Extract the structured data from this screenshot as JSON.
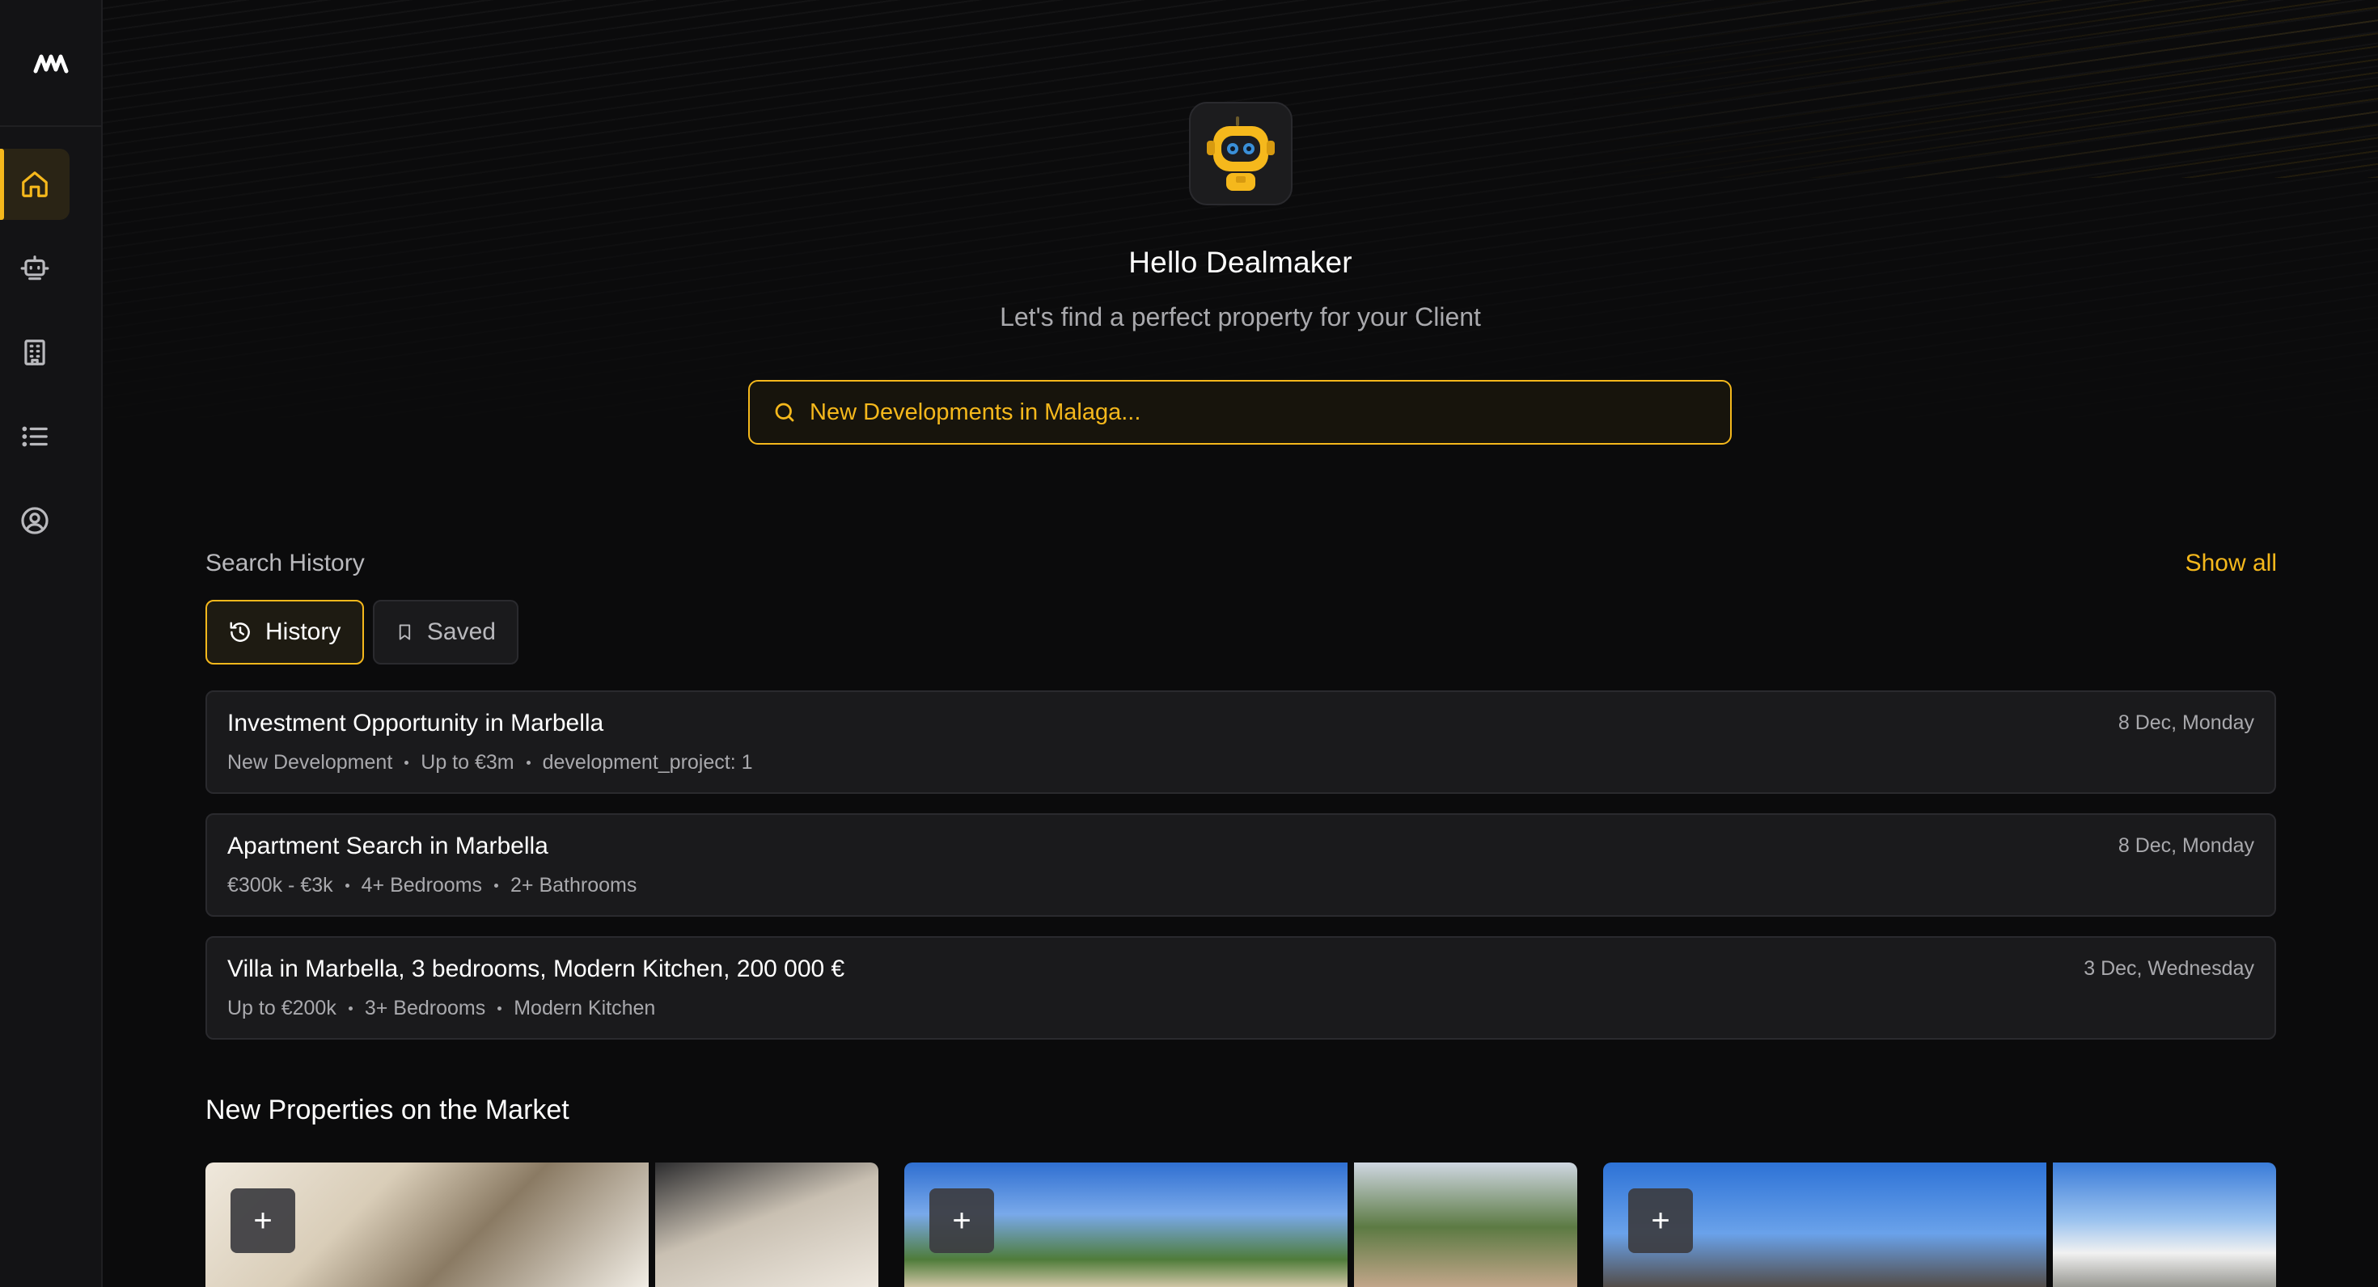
{
  "sidebar": {
    "items": [
      {
        "icon": "home-icon",
        "active": true
      },
      {
        "icon": "robot-icon"
      },
      {
        "icon": "building-icon"
      },
      {
        "icon": "list-icon"
      },
      {
        "icon": "user-circle-icon"
      }
    ]
  },
  "colors": {
    "accent": "#f5b81c",
    "background": "#0b0b0c",
    "card": "#1a1a1c"
  },
  "hero": {
    "greeting": "Hello Dealmaker",
    "subtitle": "Let's find a perfect property for your Client"
  },
  "search": {
    "placeholder": "New Developments in Malaga..."
  },
  "history": {
    "label": "Search History",
    "show_all": "Show all",
    "tabs": {
      "history": "History",
      "saved": "Saved"
    },
    "items": [
      {
        "title": "Investment Opportunity in Marbella",
        "date": "8 Dec, Monday",
        "tags": [
          "New Development",
          "Up to €3m",
          "development_project: 1"
        ]
      },
      {
        "title": "Apartment Search in Marbella",
        "date": "8 Dec, Monday",
        "tags": [
          "€300k - €3k",
          "4+ Bedrooms",
          "2+ Bathrooms"
        ]
      },
      {
        "title": "Villa in Marbella, 3 bedrooms, Modern Kitchen, 200 000 €",
        "date": "3 Dec, Wednesday",
        "tags": [
          "Up to €200k",
          "3+ Bedrooms",
          "Modern Kitchen"
        ]
      }
    ]
  },
  "properties": {
    "title": "New Properties on the Market",
    "add_label": "+"
  }
}
